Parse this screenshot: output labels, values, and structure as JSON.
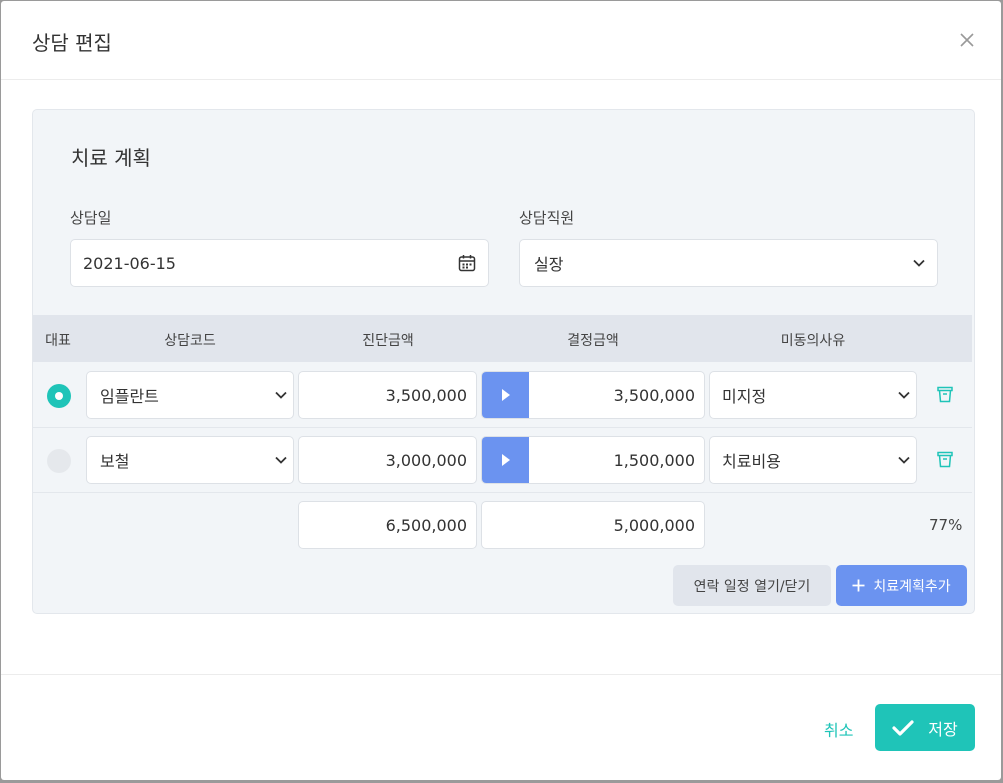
{
  "modal": {
    "title": "상담 편집"
  },
  "plan": {
    "section_title": "치료 계획",
    "date_label": "상담일",
    "date_value": "2021-06-15",
    "staff_label": "상담직원",
    "staff_value": "실장"
  },
  "table": {
    "headers": {
      "rep": "대표",
      "code": "상담코드",
      "diag": "진단금액",
      "decided": "결정금액",
      "reason": "미동의사유"
    },
    "rows": [
      {
        "selected": true,
        "code": "임플란트",
        "diag": "3,500,000",
        "decided": "3,500,000",
        "reason": "미지정"
      },
      {
        "selected": false,
        "code": "보철",
        "diag": "3,000,000",
        "decided": "1,500,000",
        "reason": "치료비용"
      }
    ],
    "totals": {
      "diag": "6,500,000",
      "decided": "5,000,000",
      "percent": "77%"
    }
  },
  "buttons": {
    "schedule_toggle": "연락 일정 열기/닫기",
    "add_plan": "치료계획추가",
    "cancel": "취소",
    "save": "저장"
  },
  "colors": {
    "teal": "#1fc4b8",
    "blue": "#6b93f0"
  }
}
